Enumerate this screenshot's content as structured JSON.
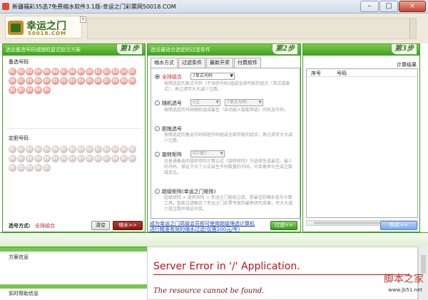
{
  "window": {
    "title": "新疆福彩35选7免费缩水软件3.1版-幸运之门彩票网50018.COM",
    "minimize": "–",
    "maximize": "□",
    "close": "×"
  },
  "banner": {
    "logo_text": "幸运之门",
    "logo_sub": "50018.COM",
    "broken_image": "×"
  },
  "step1": {
    "header": "选出备选号码或随机复式投注方案",
    "step_label": "第1步",
    "pick_label": "备选号码",
    "fixed_label": "定胆号码",
    "numbers": [
      "01",
      "02",
      "03",
      "04",
      "05",
      "06",
      "07",
      "08",
      "09",
      "10",
      "11",
      "12",
      "13",
      "14",
      "15",
      "16",
      "17",
      "18",
      "19",
      "20",
      "21",
      "22",
      "23",
      "24",
      "25",
      "26",
      "27",
      "28",
      "29",
      "30",
      "31",
      "32",
      "33",
      "34",
      "35"
    ],
    "mode_label": "选号方式:",
    "mode_value": "全排组合",
    "clear_button": "清空",
    "shrink_button": "缩水>>"
  },
  "step2": {
    "header": "选出最适合选定的过滤条件",
    "step_label": "第2步",
    "tabs": [
      "缩水方式",
      "过滤条件",
      "最新开奖",
      "付费软件"
    ],
    "options": [
      {
        "title": "全排组合",
        "select": "7单式号码",
        "desc": "按照选定的复式号码（不含胆号码)组成全部可能的组合（单式或复式），再过滤可大大减少注数。"
      },
      {
        "title": "随机选号",
        "select_a": "5注",
        "select_b": "7单式号码",
        "desc": "按照选定的号码随机组成最佳（自动嵌入智能筛选）的机选号码。"
      },
      {
        "title": "胆拖选号",
        "desc": "按照选定的备选号码和胆号码组成全部可能的组合，再过滤可大大减少注数。"
      },
      {
        "title": "旋转矩阵",
        "select": "中7保7",
        "desc": "比普通备选的旋转矩阵计算公式《旋转矩阵》为选择生成最佳。最少的号码，保证下中了公式出生不同数量的号码。中奖概率与生成注数成反比。"
      },
      {
        "title": "超级矩阵(幸运之门矩阵)",
        "desc": "超级矩阵 = 旋转矩阵 + 幸运之门智能过滤，是最佳的缩水选号计算工具。智能过滤融合了幸运之门彩票专家的最新研究成果，可大大减少投注数并保证中奖。"
      }
    ],
    "promo_line1": "成为幸运之门高级会员即可使用超级筛选计算机",
    "promo_line2": "进行精准有效的缩水过滤(仅需200元/年)",
    "filter_button": "过滤>>"
  },
  "step3": {
    "step_label": "第3步",
    "result_title": "计算结果",
    "col_index": "序号",
    "col_numbers": "号码",
    "buy_button": "购买>>"
  },
  "bottom": {
    "plan_info": "方案信息",
    "live_help": "实时帮助信息",
    "error_title": "Server Error in '/' Application.",
    "error_message": "The resource cannot be found."
  },
  "watermark": {
    "main": "脚本之家",
    "url": "www.jb51.net"
  },
  "colors": {
    "panel_green": "#3f9f22",
    "error_red": "#c0121b",
    "ball_pink": "#dd8a7d"
  }
}
